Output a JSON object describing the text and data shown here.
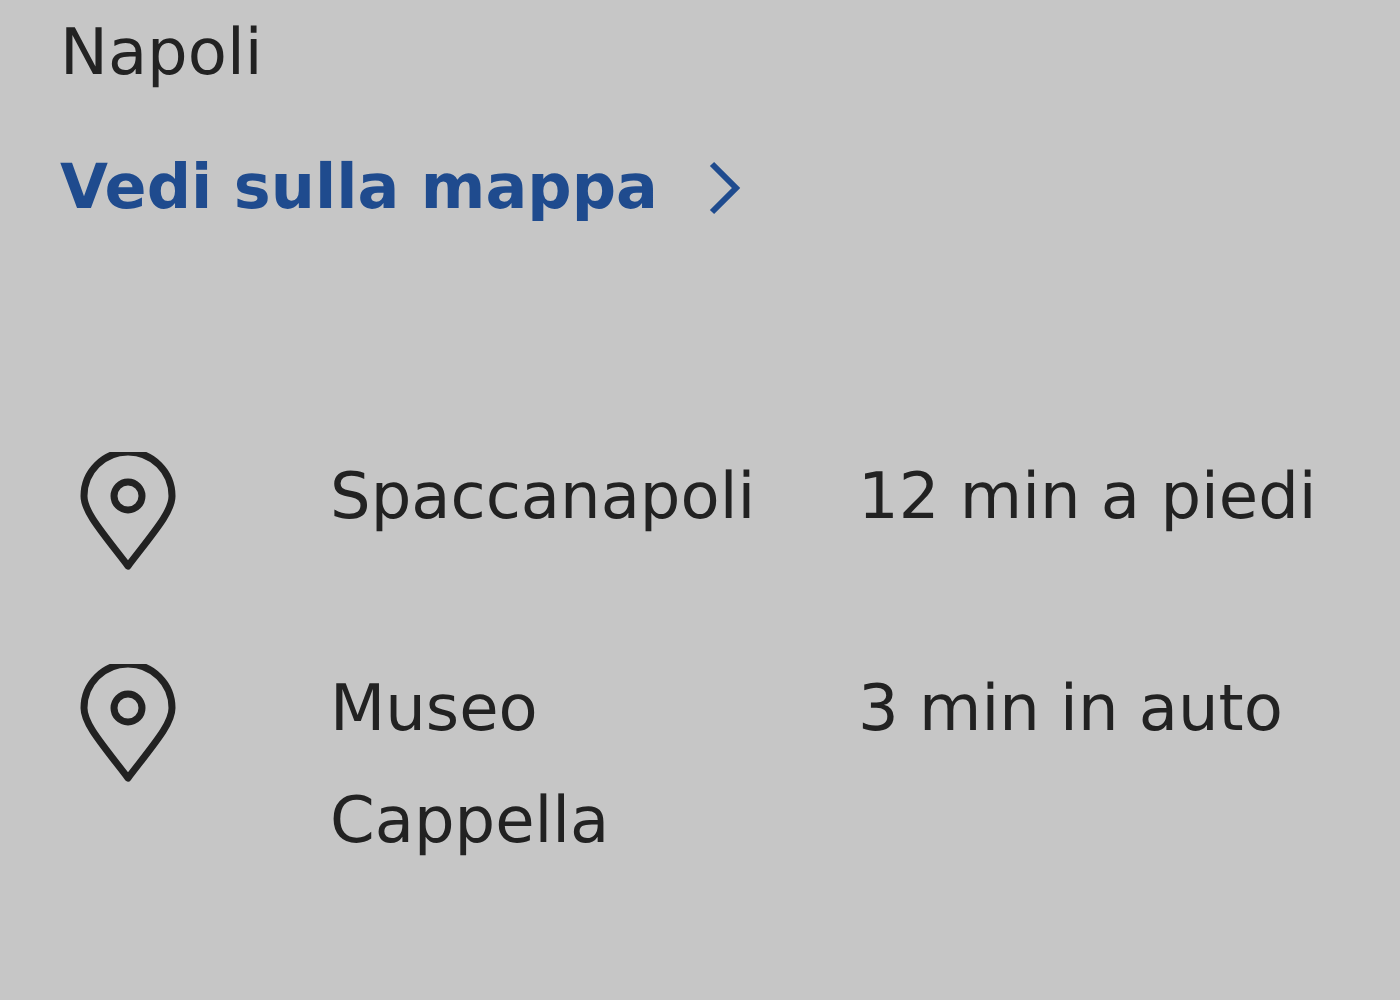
{
  "city": "Napoli",
  "map_link": {
    "label": "Vedi sulla mappa"
  },
  "places": [
    {
      "name": "Spaccanapoli",
      "distance": "12 min a piedi"
    },
    {
      "name": "Museo Cappella",
      "distance": "3 min in auto"
    }
  ]
}
